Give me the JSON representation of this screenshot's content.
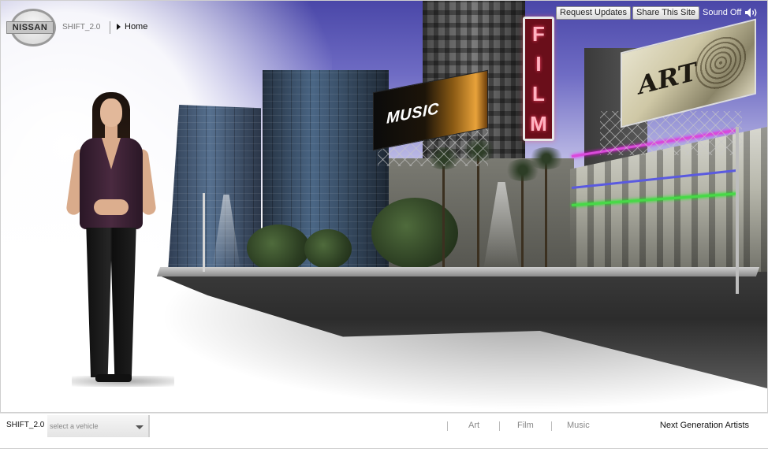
{
  "header": {
    "logo_text": "NISSAN",
    "brand": "SHIFT_2.0",
    "breadcrumb": "Home",
    "buttons": {
      "request_updates": "Request Updates",
      "share_site": "Share This Site",
      "sound": "Sound Off"
    }
  },
  "scene": {
    "billboards": {
      "music": "MUSIC",
      "film_letters": [
        "F",
        "I",
        "L",
        "M"
      ],
      "art": "ART"
    }
  },
  "footer": {
    "brand": "SHIFT_2.0",
    "vehicle_select_value": "select a vehicle",
    "links": [
      "Art",
      "Film",
      "Music"
    ],
    "next_label": "Next Generation Artists"
  },
  "icons": {
    "breadcrumb": "play-arrow-icon",
    "sound": "speaker-icon",
    "select": "chevron-down-icon"
  }
}
